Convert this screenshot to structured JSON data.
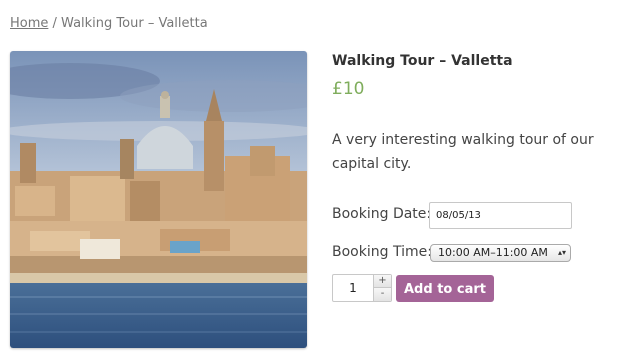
{
  "breadcrumb": {
    "home": "Home",
    "separator": " / ",
    "current": "Walking Tour – Valletta"
  },
  "product": {
    "title": "Walking Tour – Valletta",
    "price": "£10",
    "description": "A very interesting walking tour of our capital city.",
    "image_alt": "Valletta skyline across the harbour"
  },
  "booking": {
    "date_label": "Booking Date:",
    "date_value": "08/05/13",
    "time_label": "Booking Time:",
    "time_value": "10:00 AM–11:00 AM"
  },
  "cart": {
    "quantity": "1",
    "plus": "+",
    "minus": "-",
    "add_label": "Add to cart"
  },
  "colors": {
    "accent": "#a46497",
    "price": "#7fad5c"
  }
}
